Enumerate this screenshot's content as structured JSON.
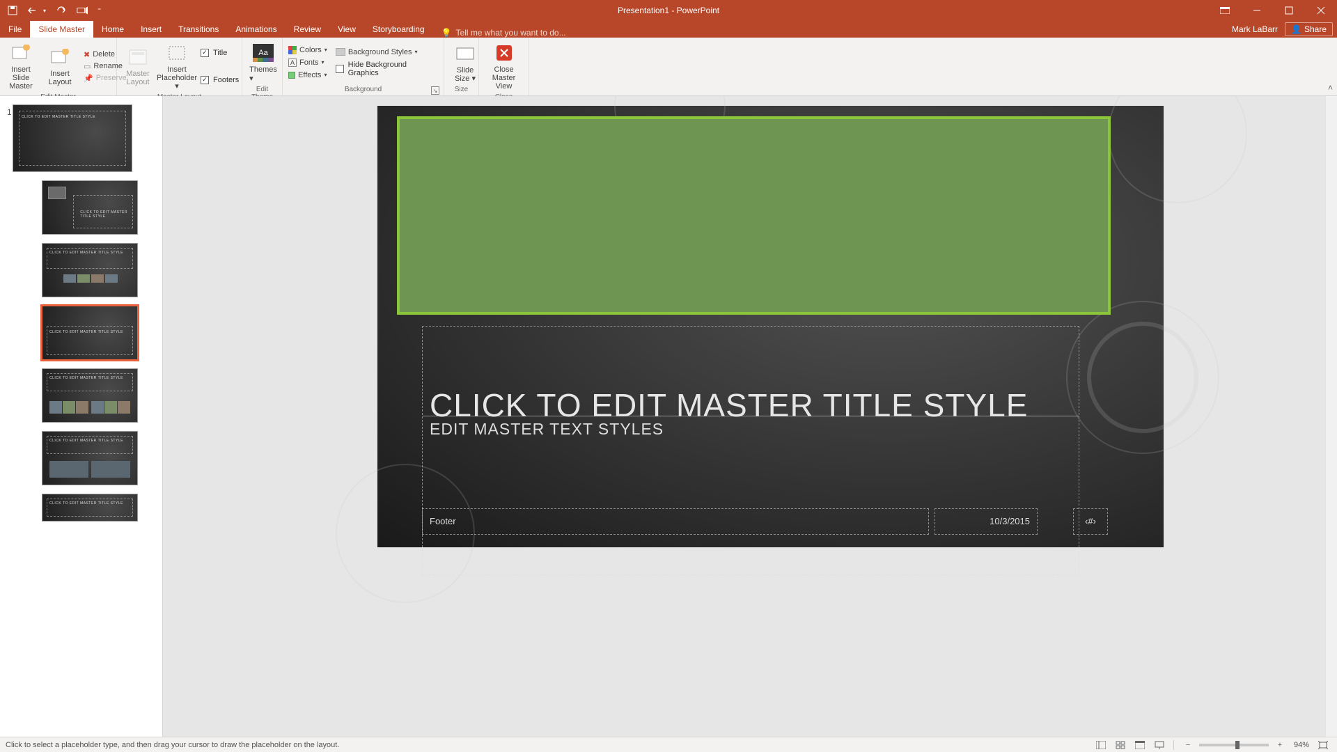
{
  "app": {
    "title": "Presentation1 - PowerPoint",
    "user": "Mark LaBarr",
    "share": "Share"
  },
  "qat": {
    "save": "save-icon",
    "undo": "undo-icon",
    "redo": "redo-icon",
    "start": "start-from-beginning-icon",
    "customize": "customize-icon"
  },
  "tabs": [
    "File",
    "Slide Master",
    "Home",
    "Insert",
    "Transitions",
    "Animations",
    "Review",
    "View",
    "Storyboarding"
  ],
  "active_tab": "Slide Master",
  "tell_me_placeholder": "Tell me what you want to do...",
  "ribbon": {
    "edit_master": {
      "label": "Edit Master",
      "insert_slide_master": "Insert Slide\nMaster",
      "insert_layout": "Insert\nLayout",
      "delete": "Delete",
      "rename": "Rename",
      "preserve": "Preserve"
    },
    "master_layout": {
      "label": "Master Layout",
      "master_layout_btn": "Master\nLayout",
      "insert_placeholder": "Insert\nPlaceholder",
      "title": "Title",
      "footers": "Footers",
      "title_checked": true,
      "footers_checked": true
    },
    "edit_theme": {
      "label": "Edit Theme",
      "themes": "Themes"
    },
    "background": {
      "label": "Background",
      "colors": "Colors",
      "fonts": "Fonts",
      "effects": "Effects",
      "bg_styles": "Background Styles",
      "hide_bg": "Hide Background Graphics",
      "hide_checked": false
    },
    "size": {
      "label": "Size",
      "slide_size": "Slide\nSize"
    },
    "close": {
      "label": "Close",
      "close_master": "Close\nMaster View"
    }
  },
  "thumbnails": {
    "master_number": "1",
    "master_title": "CLICK TO EDIT MASTER TITLE STYLE",
    "selected_index": 3,
    "layouts_count": 6
  },
  "slide": {
    "title": "CLICK TO EDIT MASTER TITLE STYLE",
    "subtitle": "EDIT MASTER TEXT STYLES",
    "footer": "Footer",
    "date": "10/3/2015",
    "slide_num": "‹#›"
  },
  "statusbar": {
    "message": "Click to select a placeholder type, and then drag your cursor to draw the placeholder on the layout.",
    "zoom": "94%"
  }
}
